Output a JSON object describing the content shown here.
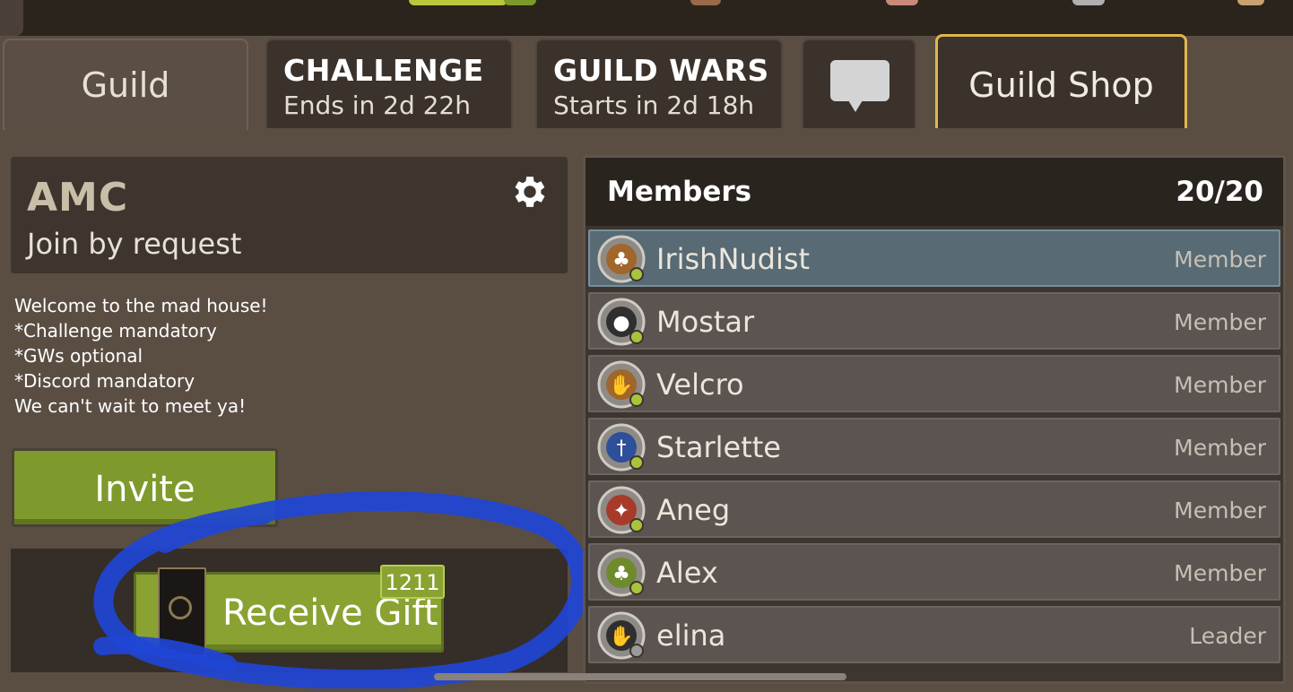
{
  "tabs": {
    "guild": {
      "label": "Guild"
    },
    "challenge": {
      "title": "CHALLENGE",
      "subtitle": "Ends in 2d 22h"
    },
    "guild_wars": {
      "title": "GUILD WARS",
      "subtitle": "Starts in 2d 18h"
    },
    "chat": {
      "icon": "chat-bubble-icon"
    },
    "shop": {
      "label": "Guild Shop"
    }
  },
  "guild": {
    "name": "AMC",
    "join_policy": "Join by request",
    "settings_icon": "gear-icon",
    "description": [
      "Welcome to the mad house!",
      "*Challenge mandatory",
      "*GWs optional",
      "*Discord mandatory",
      "We can't wait to meet ya!"
    ]
  },
  "actions": {
    "invite_label": "Invite",
    "receive_gift_label": "Receive Gift",
    "gift_count": "1211"
  },
  "members": {
    "title": "Members",
    "count": "20/20",
    "list": [
      {
        "name": "IrishNudist",
        "role": "Member",
        "avatar_icon": "clover-icon",
        "avatar_color": "#a0662a",
        "online": true
      },
      {
        "name": "Mostar",
        "role": "Member",
        "avatar_icon": "grenade-icon",
        "avatar_color": "#2f2f2f",
        "online": true
      },
      {
        "name": "Velcro",
        "role": "Member",
        "avatar_icon": "hand-icon",
        "avatar_color": "#a0662a",
        "online": true
      },
      {
        "name": "Starlette",
        "role": "Member",
        "avatar_icon": "dagger-icon",
        "avatar_color": "#2e4f9a",
        "online": true
      },
      {
        "name": "Aneg",
        "role": "Member",
        "avatar_icon": "squirrel-icon",
        "avatar_color": "#a83a2a",
        "online": true
      },
      {
        "name": "Alex",
        "role": "Member",
        "avatar_icon": "clover-icon",
        "avatar_color": "#6e8a2c",
        "online": true
      },
      {
        "name": "elina",
        "role": "Leader",
        "avatar_icon": "hand-icon",
        "avatar_color": "#2f2f2f",
        "online": false
      }
    ]
  },
  "colors": {
    "online": "#a8c43a",
    "offline": "#9a9a9a",
    "accent_gold": "#e0b64d",
    "button_green": "#8aa231",
    "annotation_blue": "#1f45d6"
  }
}
